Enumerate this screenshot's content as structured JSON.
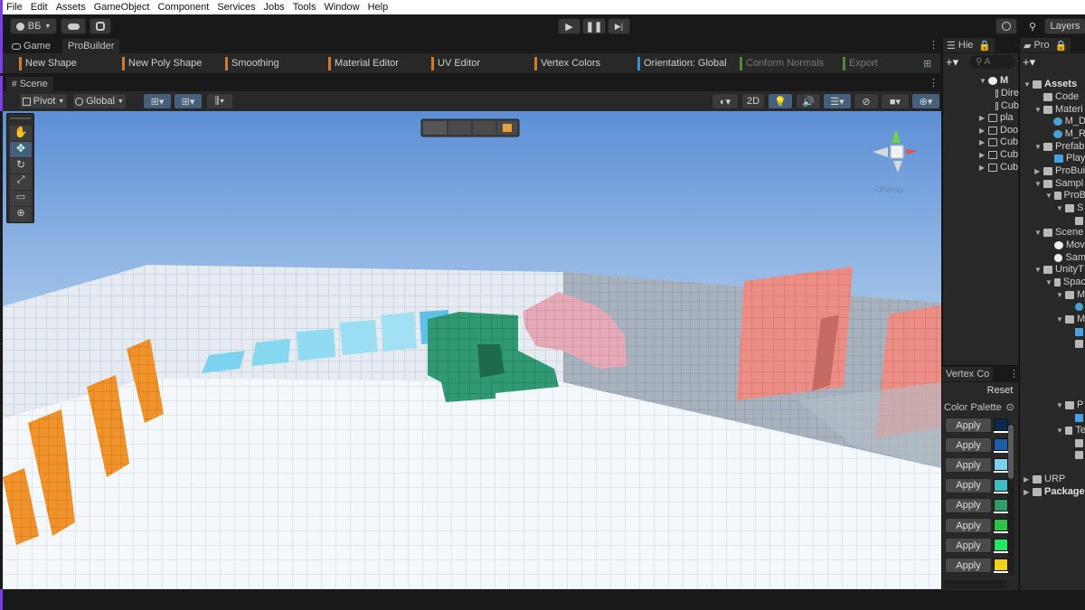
{
  "menu": [
    "File",
    "Edit",
    "Assets",
    "GameObject",
    "Component",
    "Services",
    "Jobs",
    "Tools",
    "Window",
    "Help"
  ],
  "toolbar": {
    "account_label": "ВБ",
    "layers_label": "Layers"
  },
  "tabs": {
    "game": "Game",
    "probuilder": "ProBuilder",
    "scene": "Scene"
  },
  "probuilder": [
    {
      "label": "New Shape",
      "color": "#d17a2a",
      "dim": false
    },
    {
      "label": "New Poly Shape",
      "color": "#d17a2a",
      "dim": false
    },
    {
      "label": "Smoothing",
      "color": "#d17a2a",
      "dim": false
    },
    {
      "label": "Material Editor",
      "color": "#d17a2a",
      "dim": false
    },
    {
      "label": "UV Editor",
      "color": "#d17a2a",
      "dim": false
    },
    {
      "label": "Vertex Colors",
      "color": "#d17a2a",
      "dim": false
    },
    {
      "label": "Orientation: Global",
      "color": "#3a8fd0",
      "dim": false
    },
    {
      "label": "Conform Normals",
      "color": "#4a8a3a",
      "dim": true
    },
    {
      "label": "Export",
      "color": "#4a8a3a",
      "dim": true
    }
  ],
  "scene_toolbar": {
    "pivot": "Pivot",
    "global": "Global",
    "mode_2d": "2D"
  },
  "viewport": {
    "persp_label": "<Persp"
  },
  "hierarchy": {
    "tab": "Hie",
    "search_placeholder": "A",
    "items": [
      "M",
      "Dire",
      "Cub",
      "pla",
      "Doo",
      "Cub",
      "Cub",
      "Cub"
    ]
  },
  "project": {
    "tab": "Pro",
    "items": [
      "Assets",
      "Code",
      "Materi",
      "M_D",
      "M_R",
      "Prefab",
      "Play",
      "ProBui",
      "Sampl",
      "ProB",
      "S",
      "",
      "Scene",
      "Mov",
      "Sam",
      "UnityT",
      "Spac",
      "M",
      "",
      "M",
      "",
      "",
      "P",
      "",
      "Te",
      "",
      "",
      "URP",
      "Package"
    ]
  },
  "vertex_colors": {
    "tab": "Vertex Co",
    "reset": "Reset",
    "palette_label": "Color Palette",
    "apply_label": "Apply",
    "swatches": [
      "#0d2a4c",
      "#1d5ea8",
      "#7fd0ef",
      "#3dbdc8",
      "#2f9c6a",
      "#2fc24a",
      "#22e866",
      "#f2d21a"
    ]
  }
}
